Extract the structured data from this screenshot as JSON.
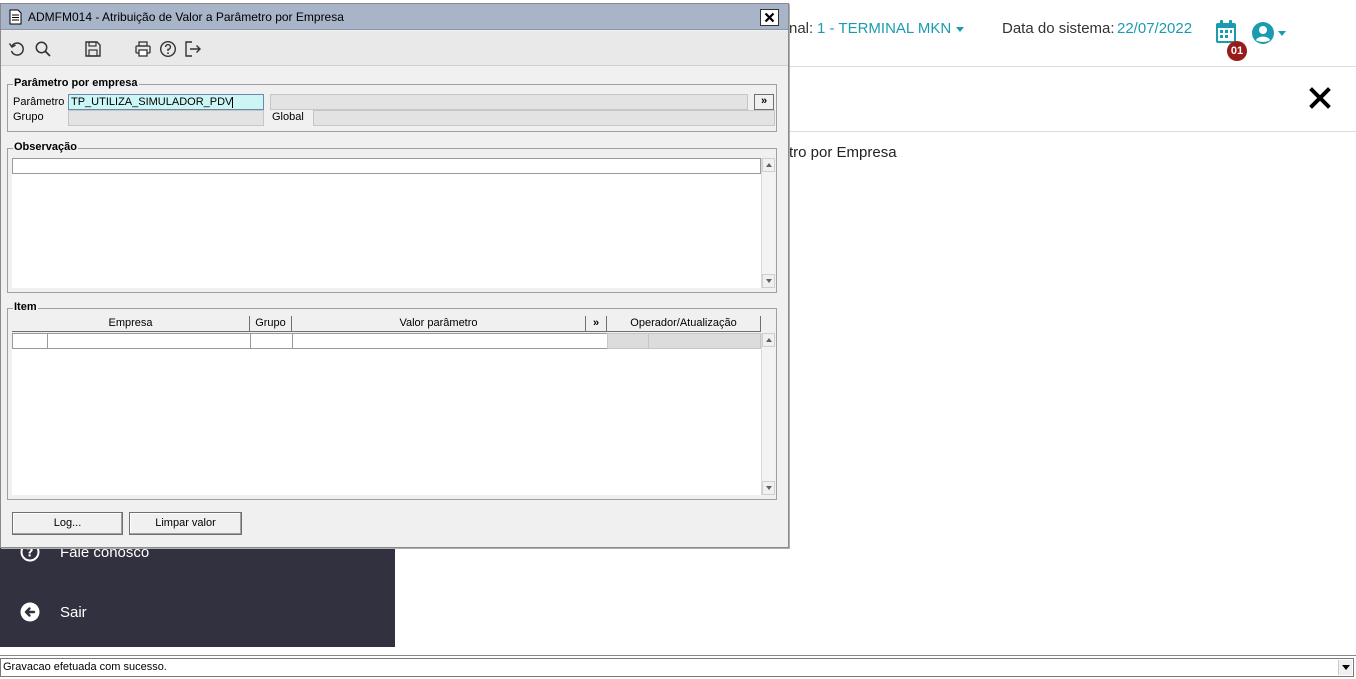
{
  "header": {
    "terminal_label": "nal:",
    "terminal_value": "1 - TERMINAL MKN",
    "date_label": "Data do sistema:",
    "date_value": "22/07/2022",
    "calendar_badge": "01",
    "accent_color": "#1a9bb0",
    "badge_color": "#9a1a1a"
  },
  "page": {
    "heading": "tro por Empresa"
  },
  "sidebar": {
    "items": [
      {
        "label": "Fale conosco",
        "icon": "question-icon"
      },
      {
        "label": "Sair",
        "icon": "exit-arrow-icon"
      }
    ]
  },
  "window": {
    "title": "ADMFM014 - Atribuição de Valor a Parâmetro por Empresa",
    "toolbar": [
      "undo-icon",
      "search-icon",
      "save-icon",
      "print-icon",
      "help-icon",
      "exit-icon"
    ],
    "param_group": {
      "title": "Parâmetro por empresa",
      "param_label": "Parâmetro",
      "param_value": "TP_UTILIZA_SIMULADOR_PDV",
      "param_desc": "",
      "more_button": "»",
      "grupo_label": "Grupo",
      "grupo_value": "",
      "global_label": "Global",
      "global_value": ""
    },
    "obs_group": {
      "title": "Observação",
      "value": ""
    },
    "item_group": {
      "title": "Item",
      "columns": [
        "Empresa",
        "Grupo",
        "Valor parâmetro",
        "»",
        "Operador/Atualização"
      ]
    },
    "buttons": {
      "log": "Log...",
      "clear": "Limpar valor"
    }
  },
  "statusbar": {
    "message": "Gravacao efetuada com sucesso."
  }
}
